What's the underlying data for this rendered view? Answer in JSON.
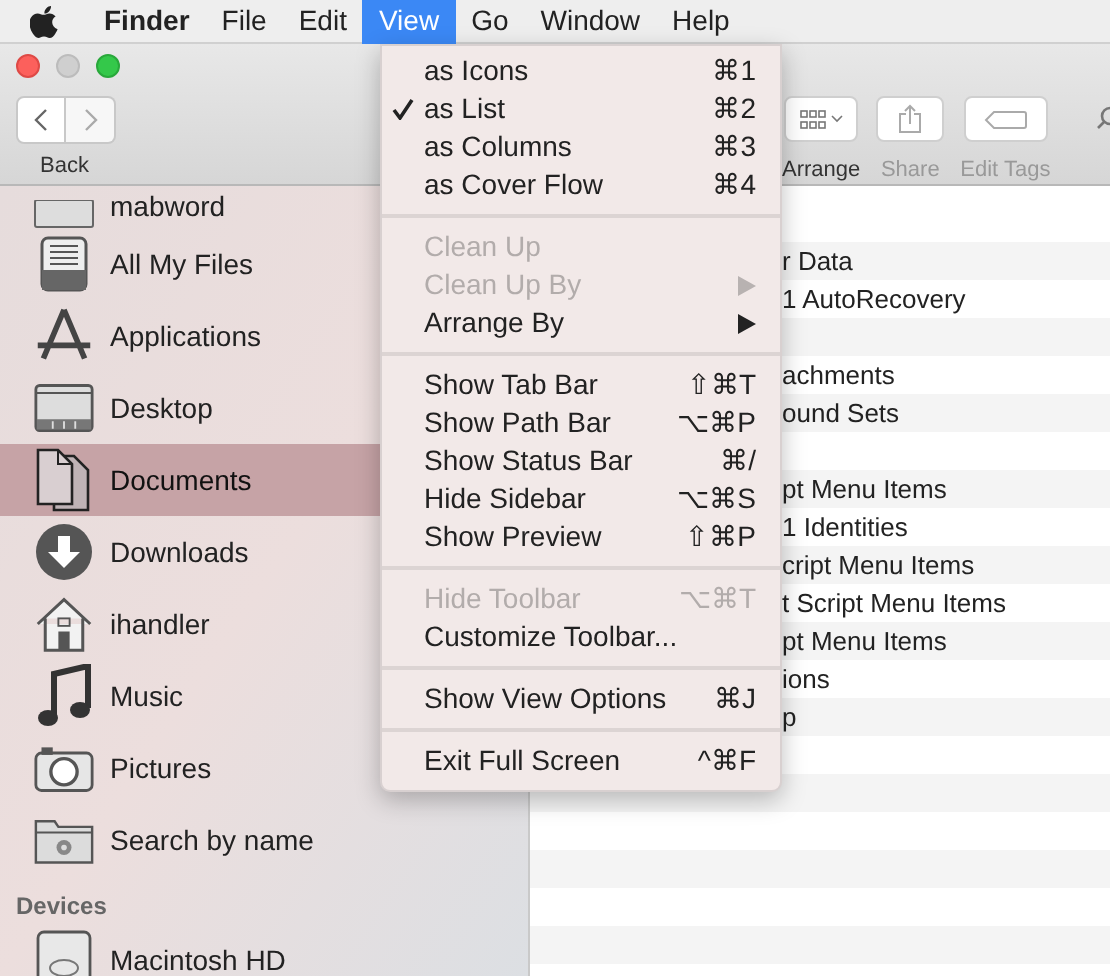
{
  "menu_bar": {
    "items": [
      {
        "label": "Finder",
        "selected": false,
        "bold": true
      },
      {
        "label": "File",
        "selected": false,
        "bold": false
      },
      {
        "label": "Edit",
        "selected": false,
        "bold": false
      },
      {
        "label": "View",
        "selected": true,
        "bold": false
      },
      {
        "label": "Go",
        "selected": false,
        "bold": false
      },
      {
        "label": "Window",
        "selected": false,
        "bold": false
      },
      {
        "label": "Help",
        "selected": false,
        "bold": false
      }
    ]
  },
  "toolbar": {
    "back_label": "Back",
    "buttons": [
      {
        "label": "Arrange"
      },
      {
        "label": "Share"
      },
      {
        "label": "Edit Tags"
      }
    ]
  },
  "sidebar": {
    "items": [
      {
        "label": "mabword",
        "selected": false
      },
      {
        "label": "All My Files",
        "selected": false
      },
      {
        "label": "Applications",
        "selected": false
      },
      {
        "label": "Desktop",
        "selected": false
      },
      {
        "label": "Documents",
        "selected": true
      },
      {
        "label": "Downloads",
        "selected": false
      },
      {
        "label": "ihandler",
        "selected": false
      },
      {
        "label": "Music",
        "selected": false
      },
      {
        "label": "Pictures",
        "selected": false
      },
      {
        "label": "Search by name",
        "selected": false
      }
    ],
    "devices_heading": "Devices",
    "devices": [
      {
        "label": "Macintosh HD",
        "selected": false
      }
    ]
  },
  "files": [
    {
      "kind": "file",
      "name": "r Data"
    },
    {
      "kind": "file",
      "name": "1 AutoRecovery"
    },
    {
      "kind": "blank"
    },
    {
      "kind": "file",
      "name": "achments"
    },
    {
      "kind": "file",
      "name": "ound Sets"
    },
    {
      "kind": "blank"
    },
    {
      "kind": "file",
      "name": "pt Menu Items"
    },
    {
      "kind": "file",
      "name": "1 Identities"
    },
    {
      "kind": "file",
      "name": "cript Menu Items"
    },
    {
      "kind": "file",
      "name": "t Script Menu Items"
    },
    {
      "kind": "file",
      "name": "pt Menu Items"
    },
    {
      "kind": "file",
      "name": "ions"
    },
    {
      "kind": "file",
      "name": "p"
    }
  ],
  "view_menu": [
    {
      "kind": "item",
      "label": "as Icons",
      "shortcut": "⌘1",
      "checked": false,
      "disabled": false,
      "submenu": false
    },
    {
      "kind": "item",
      "label": "as List",
      "shortcut": "⌘2",
      "checked": true,
      "disabled": false,
      "submenu": false
    },
    {
      "kind": "item",
      "label": "as Columns",
      "shortcut": "⌘3",
      "checked": false,
      "disabled": false,
      "submenu": false
    },
    {
      "kind": "item",
      "label": "as Cover Flow",
      "shortcut": "⌘4",
      "checked": false,
      "disabled": false,
      "submenu": false
    },
    {
      "kind": "separator"
    },
    {
      "kind": "item",
      "label": "Clean Up",
      "checked": false,
      "disabled": true,
      "submenu": false
    },
    {
      "kind": "item",
      "label": "Clean Up By",
      "checked": false,
      "disabled": true,
      "submenu": true
    },
    {
      "kind": "item",
      "label": "Arrange By",
      "checked": false,
      "disabled": false,
      "submenu": true
    },
    {
      "kind": "separator"
    },
    {
      "kind": "item",
      "label": "Show Tab Bar",
      "shortcut": "⇧⌘T",
      "checked": false,
      "disabled": false,
      "submenu": false
    },
    {
      "kind": "item",
      "label": "Show Path Bar",
      "shortcut": "⌥⌘P",
      "checked": false,
      "disabled": false,
      "submenu": false
    },
    {
      "kind": "item",
      "label": "Show Status Bar",
      "shortcut": "⌘/",
      "checked": false,
      "disabled": false,
      "submenu": false
    },
    {
      "kind": "item",
      "label": "Hide Sidebar",
      "shortcut": "⌥⌘S",
      "checked": false,
      "disabled": false,
      "submenu": false
    },
    {
      "kind": "item",
      "label": "Show Preview",
      "shortcut": "⇧⌘P",
      "checked": false,
      "disabled": false,
      "submenu": false
    },
    {
      "kind": "separator"
    },
    {
      "kind": "item",
      "label": "Hide Toolbar",
      "shortcut": "⌥⌘T",
      "checked": false,
      "disabled": true,
      "submenu": false
    },
    {
      "kind": "item",
      "label": "Customize Toolbar...",
      "checked": false,
      "disabled": false,
      "submenu": false
    },
    {
      "kind": "separator"
    },
    {
      "kind": "item",
      "label": "Show View Options",
      "shortcut": "⌘J",
      "checked": false,
      "disabled": false,
      "submenu": false
    },
    {
      "kind": "separator"
    },
    {
      "kind": "item",
      "label": "Exit Full Screen",
      "shortcut": "^⌘F",
      "checked": false,
      "disabled": false,
      "submenu": false
    }
  ]
}
